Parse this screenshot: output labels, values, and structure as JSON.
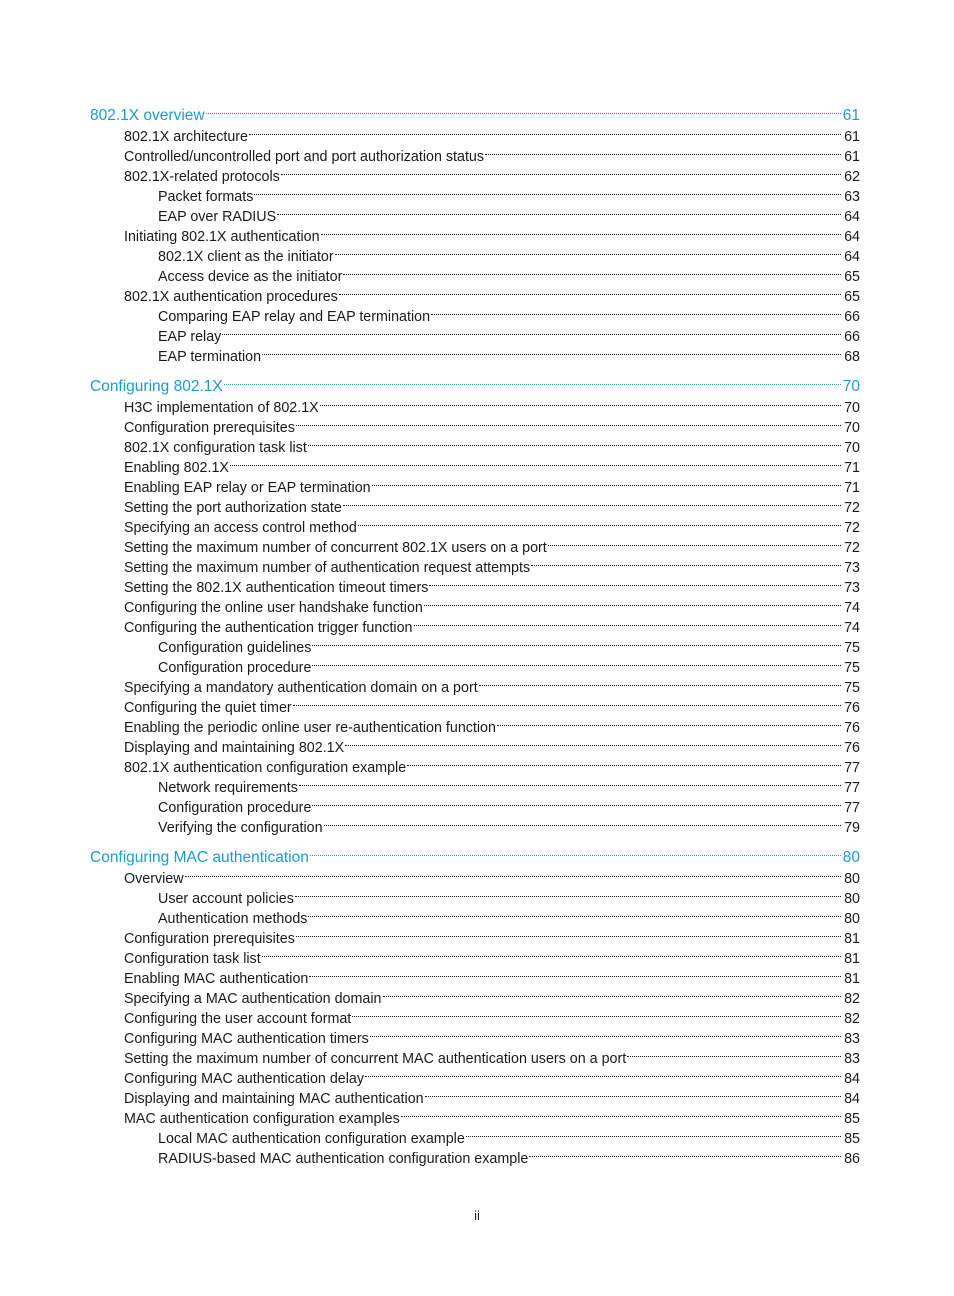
{
  "accent_color": "#1a9bd1",
  "sections": [
    {
      "title": "802.1X overview",
      "page": "61",
      "entries": [
        {
          "level": 2,
          "title": "802.1X architecture",
          "page": "61"
        },
        {
          "level": 2,
          "title": "Controlled/uncontrolled port and port authorization status",
          "page": "61"
        },
        {
          "level": 2,
          "title": "802.1X-related protocols",
          "page": "62"
        },
        {
          "level": 3,
          "title": "Packet formats",
          "page": "63"
        },
        {
          "level": 3,
          "title": "EAP over RADIUS",
          "page": "64"
        },
        {
          "level": 2,
          "title": "Initiating 802.1X authentication",
          "page": "64"
        },
        {
          "level": 3,
          "title": "802.1X client as the initiator",
          "page": "64"
        },
        {
          "level": 3,
          "title": "Access device as the initiator",
          "page": "65"
        },
        {
          "level": 2,
          "title": "802.1X authentication procedures",
          "page": "65"
        },
        {
          "level": 3,
          "title": "Comparing EAP relay and EAP termination",
          "page": "66"
        },
        {
          "level": 3,
          "title": "EAP relay",
          "page": "66"
        },
        {
          "level": 3,
          "title": "EAP termination",
          "page": "68"
        }
      ]
    },
    {
      "title": "Configuring 802.1X",
      "page": "70",
      "entries": [
        {
          "level": 2,
          "title": "H3C implementation of 802.1X",
          "page": "70"
        },
        {
          "level": 2,
          "title": "Configuration prerequisites",
          "page": "70"
        },
        {
          "level": 2,
          "title": "802.1X configuration task list",
          "page": "70"
        },
        {
          "level": 2,
          "title": "Enabling 802.1X",
          "page": "71"
        },
        {
          "level": 2,
          "title": "Enabling EAP relay or EAP termination",
          "page": "71"
        },
        {
          "level": 2,
          "title": "Setting the port authorization state",
          "page": "72"
        },
        {
          "level": 2,
          "title": "Specifying an access control method",
          "page": "72"
        },
        {
          "level": 2,
          "title": "Setting the maximum number of concurrent 802.1X users on a port",
          "page": "72"
        },
        {
          "level": 2,
          "title": "Setting the maximum number of authentication request attempts",
          "page": "73"
        },
        {
          "level": 2,
          "title": "Setting the 802.1X authentication timeout timers",
          "page": "73"
        },
        {
          "level": 2,
          "title": "Configuring the online user handshake function",
          "page": "74"
        },
        {
          "level": 2,
          "title": "Configuring the authentication trigger function",
          "page": "74"
        },
        {
          "level": 3,
          "title": "Configuration guidelines",
          "page": "75"
        },
        {
          "level": 3,
          "title": "Configuration procedure",
          "page": "75"
        },
        {
          "level": 2,
          "title": "Specifying a mandatory authentication domain on a port",
          "page": "75"
        },
        {
          "level": 2,
          "title": "Configuring the quiet timer",
          "page": "76"
        },
        {
          "level": 2,
          "title": "Enabling the periodic online user re-authentication function",
          "page": "76"
        },
        {
          "level": 2,
          "title": "Displaying and maintaining 802.1X",
          "page": "76"
        },
        {
          "level": 2,
          "title": "802.1X authentication configuration example",
          "page": "77"
        },
        {
          "level": 3,
          "title": "Network requirements",
          "page": "77"
        },
        {
          "level": 3,
          "title": "Configuration procedure",
          "page": "77"
        },
        {
          "level": 3,
          "title": "Verifying the configuration",
          "page": "79"
        }
      ]
    },
    {
      "title": "Configuring MAC authentication",
      "page": "80",
      "entries": [
        {
          "level": 2,
          "title": "Overview",
          "page": "80"
        },
        {
          "level": 3,
          "title": "User account policies",
          "page": "80"
        },
        {
          "level": 3,
          "title": "Authentication methods",
          "page": "80"
        },
        {
          "level": 2,
          "title": "Configuration prerequisites",
          "page": "81"
        },
        {
          "level": 2,
          "title": "Configuration task list",
          "page": "81"
        },
        {
          "level": 2,
          "title": "Enabling MAC authentication",
          "page": "81"
        },
        {
          "level": 2,
          "title": "Specifying a MAC authentication domain",
          "page": "82"
        },
        {
          "level": 2,
          "title": "Configuring the user account format",
          "page": "82"
        },
        {
          "level": 2,
          "title": "Configuring MAC authentication timers",
          "page": "83"
        },
        {
          "level": 2,
          "title": "Setting the maximum number of concurrent MAC authentication users on a port",
          "page": "83"
        },
        {
          "level": 2,
          "title": "Configuring MAC authentication delay",
          "page": "84"
        },
        {
          "level": 2,
          "title": "Displaying and maintaining MAC authentication",
          "page": "84"
        },
        {
          "level": 2,
          "title": "MAC authentication configuration examples",
          "page": "85"
        },
        {
          "level": 3,
          "title": "Local MAC authentication configuration example",
          "page": "85"
        },
        {
          "level": 3,
          "title": "RADIUS-based MAC authentication configuration example",
          "page": "86"
        }
      ]
    }
  ],
  "footer": {
    "page_number": "ii"
  }
}
